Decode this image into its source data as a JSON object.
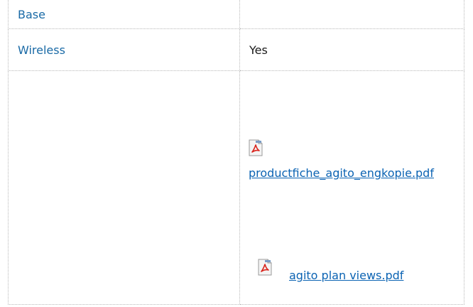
{
  "rows": [
    {
      "label": "Base",
      "value": ""
    },
    {
      "label": "Wireless",
      "value": "Yes"
    }
  ],
  "documents": [
    {
      "icon": "pdf-file-icon",
      "filename": "productfiche_agito_engkopie.pdf"
    },
    {
      "icon": "pdf-file-icon",
      "filename": "agito plan views.pdf"
    }
  ],
  "colors": {
    "label": "#1a6aa6",
    "link": "#0b63b3",
    "border": "#b8b8b8",
    "pdf_red": "#d9231c"
  }
}
